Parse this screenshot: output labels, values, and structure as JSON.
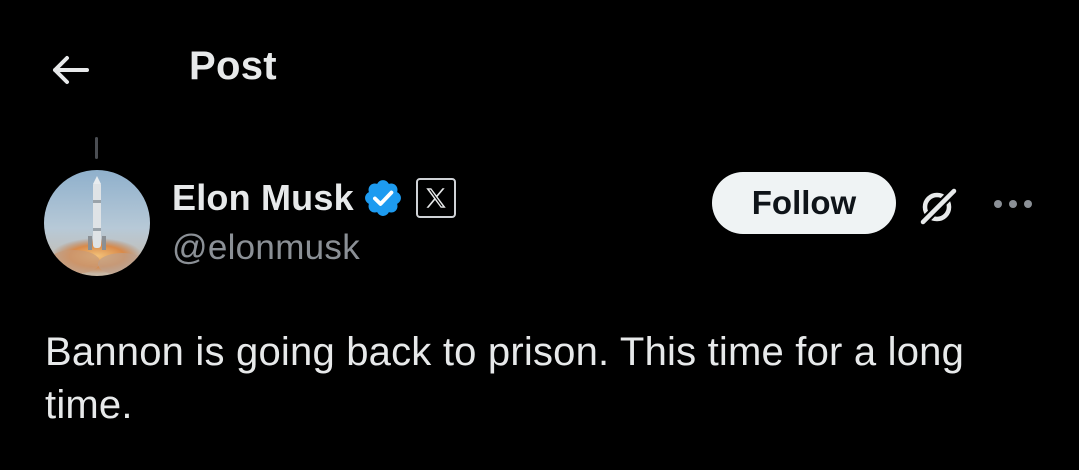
{
  "header": {
    "title": "Post",
    "back_icon": "arrow-left-icon"
  },
  "post": {
    "author": {
      "name": "Elon Musk",
      "handle": "@elonmusk",
      "verified_icon": "verified-badge-icon",
      "verified_color": "#1d9bf0",
      "affiliation_icon": "x-logo-icon"
    },
    "follow_label": "Follow",
    "grok_icon": "grok-icon",
    "more_icon": "more-horizontal-icon",
    "text": "Bannon is going back to prison. This time for a long time."
  },
  "colors": {
    "background": "#000000",
    "primary_text": "#e7e9ea",
    "secondary_text": "#8b9096",
    "follow_bg": "#eff3f4",
    "follow_text": "#0f1419"
  }
}
